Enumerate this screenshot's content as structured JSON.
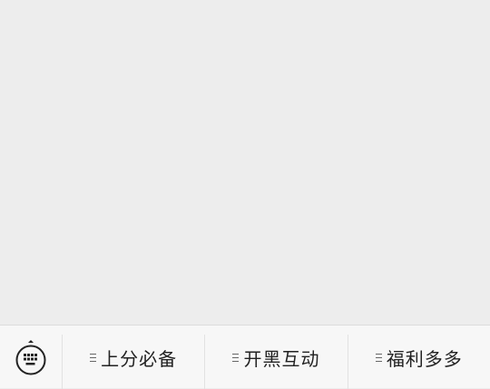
{
  "bottom_menu": {
    "keyboard_icon": "keyboard-icon",
    "items": [
      {
        "label": "上分必备",
        "icon": "submenu-lines-icon"
      },
      {
        "label": "开黑互动",
        "icon": "submenu-lines-icon"
      },
      {
        "label": "福利多多",
        "icon": "submenu-lines-icon"
      }
    ]
  },
  "colors": {
    "background": "#ededed",
    "bar_background": "#f7f7f7",
    "text": "#222222"
  }
}
